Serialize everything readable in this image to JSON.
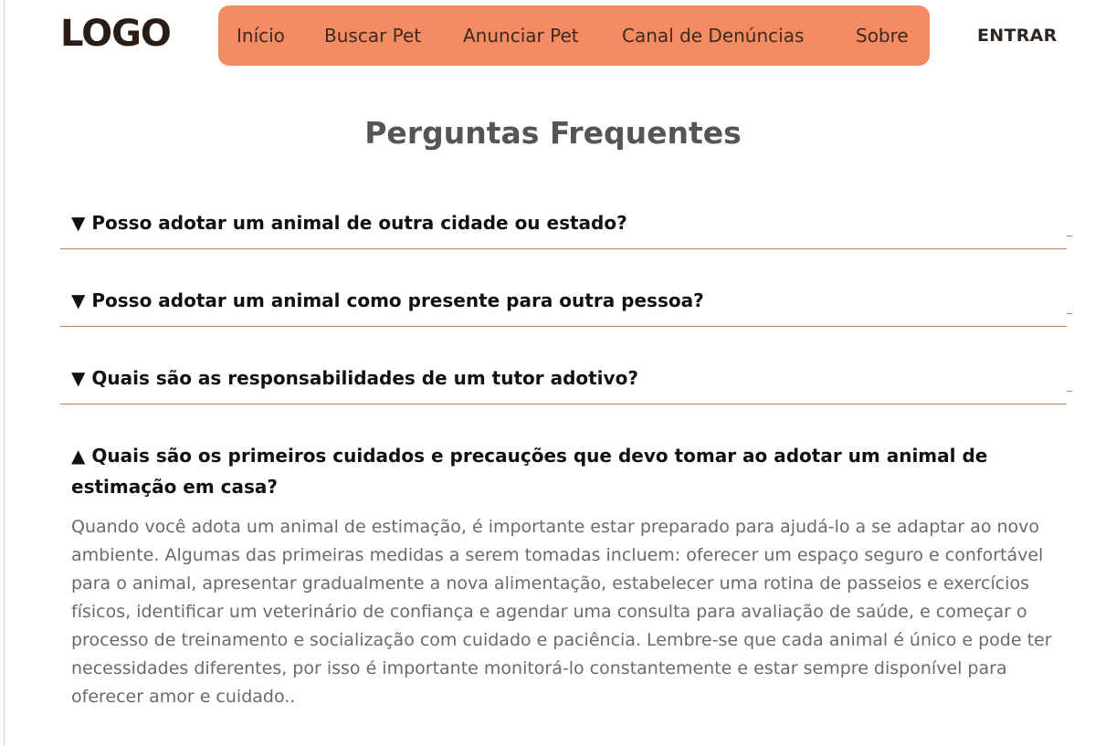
{
  "header": {
    "logo": "LOGO",
    "nav": [
      "Início",
      "Buscar Pet",
      "Anunciar Pet",
      "Canal de Denúncias",
      "Sobre"
    ],
    "login": "ENTRAR"
  },
  "page_title": "Perguntas Frequentes",
  "faq": {
    "collapsed": [
      {
        "marker": "▼",
        "question": "Posso adotar um animal de outra cidade ou estado?"
      },
      {
        "marker": "▼",
        "question": "Posso adotar um animal como presente para outra pessoa?"
      },
      {
        "marker": "▼",
        "question": "Quais são as responsabilidades de um tutor adotivo?"
      }
    ],
    "expanded": {
      "marker": "▲",
      "question": "Quais são os primeiros cuidados e precauções que devo tomar ao adotar um animal de estimação em casa?",
      "answer": "Quando você adota um animal de estimação, é importante estar preparado para ajudá-lo a se adaptar ao novo ambiente. Algumas das primeiras medidas a serem tomadas incluem: oferecer um espaço seguro e confortável para o animal, apresentar gradualmente a nova alimentação, estabelecer uma rotina de passeios e exercícios físicos, identificar um veterinário de confiança e agendar uma consulta para avaliação de saúde, e começar o processo de treinamento e socialização com cuidado e paciência. Lembre-se que cada animal é único e pode ter necessidades diferentes, por isso é importante monitorá-lo constantemente e estar sempre disponível para oferecer amor e cuidado.."
    }
  },
  "colors": {
    "nav_background": "#f58b63",
    "divider": "#c97c55",
    "heading": "#555555",
    "answer_text": "#6a6a6a"
  }
}
